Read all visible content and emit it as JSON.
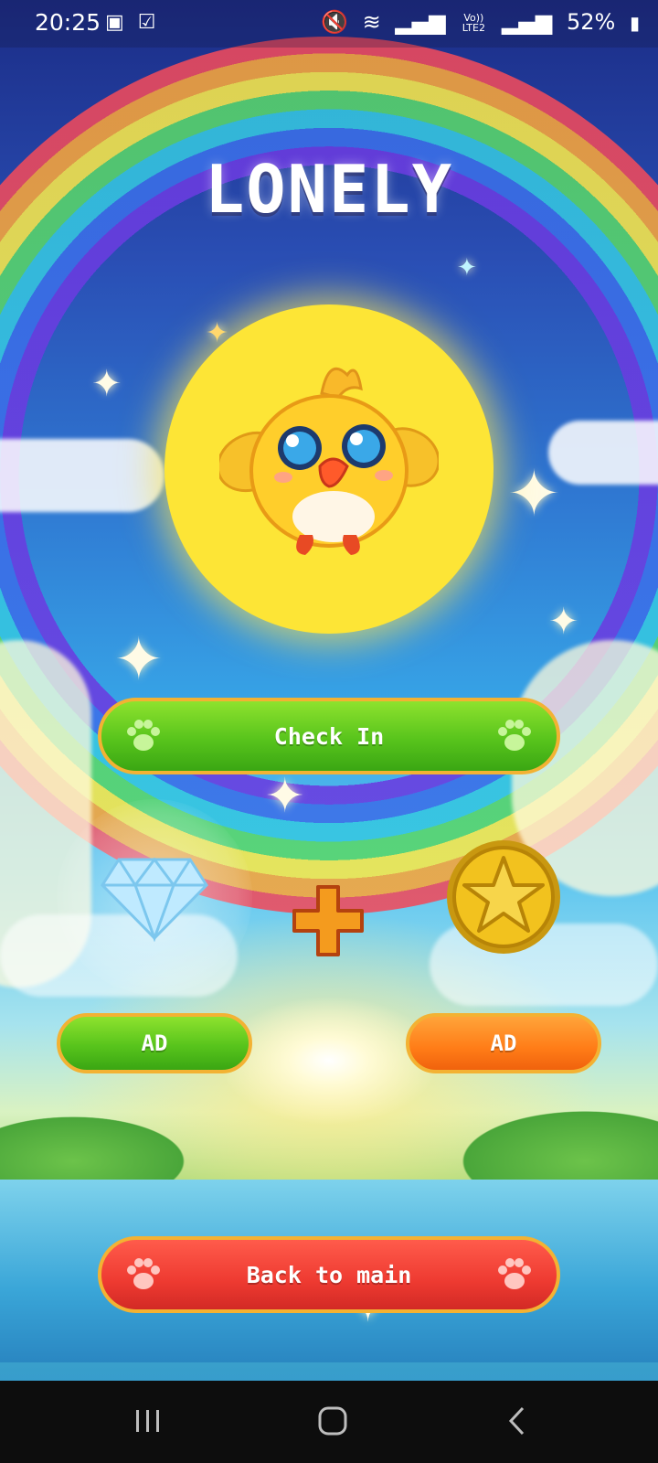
{
  "status_bar": {
    "time": "20:25",
    "battery": "52%",
    "left_icons": [
      "gallery-icon",
      "check-square-icon"
    ],
    "right_icons": [
      "mute-icon",
      "wifi-icon",
      "signal-icon",
      "volte-icon",
      "signal-icon",
      "battery-icon"
    ],
    "volte_label": "Vo)) LTE2"
  },
  "game": {
    "title": "LONELY",
    "character": "yellow-chick",
    "check_in_label": "Check In",
    "reward_left_icon": "diamond-icon",
    "reward_plus_icon": "plus-icon",
    "reward_right_icon": "star-coin-icon",
    "ad_left_label": "AD",
    "ad_right_label": "AD",
    "back_label": "Back to main"
  },
  "colors": {
    "green": "#58c41c",
    "orange": "#ff7c17",
    "red": "#ee3a31",
    "gold_border": "#f3b233",
    "avatar_bg": "#fde536"
  },
  "navbar": {
    "items": [
      "recents-icon",
      "home-icon",
      "back-icon"
    ]
  }
}
